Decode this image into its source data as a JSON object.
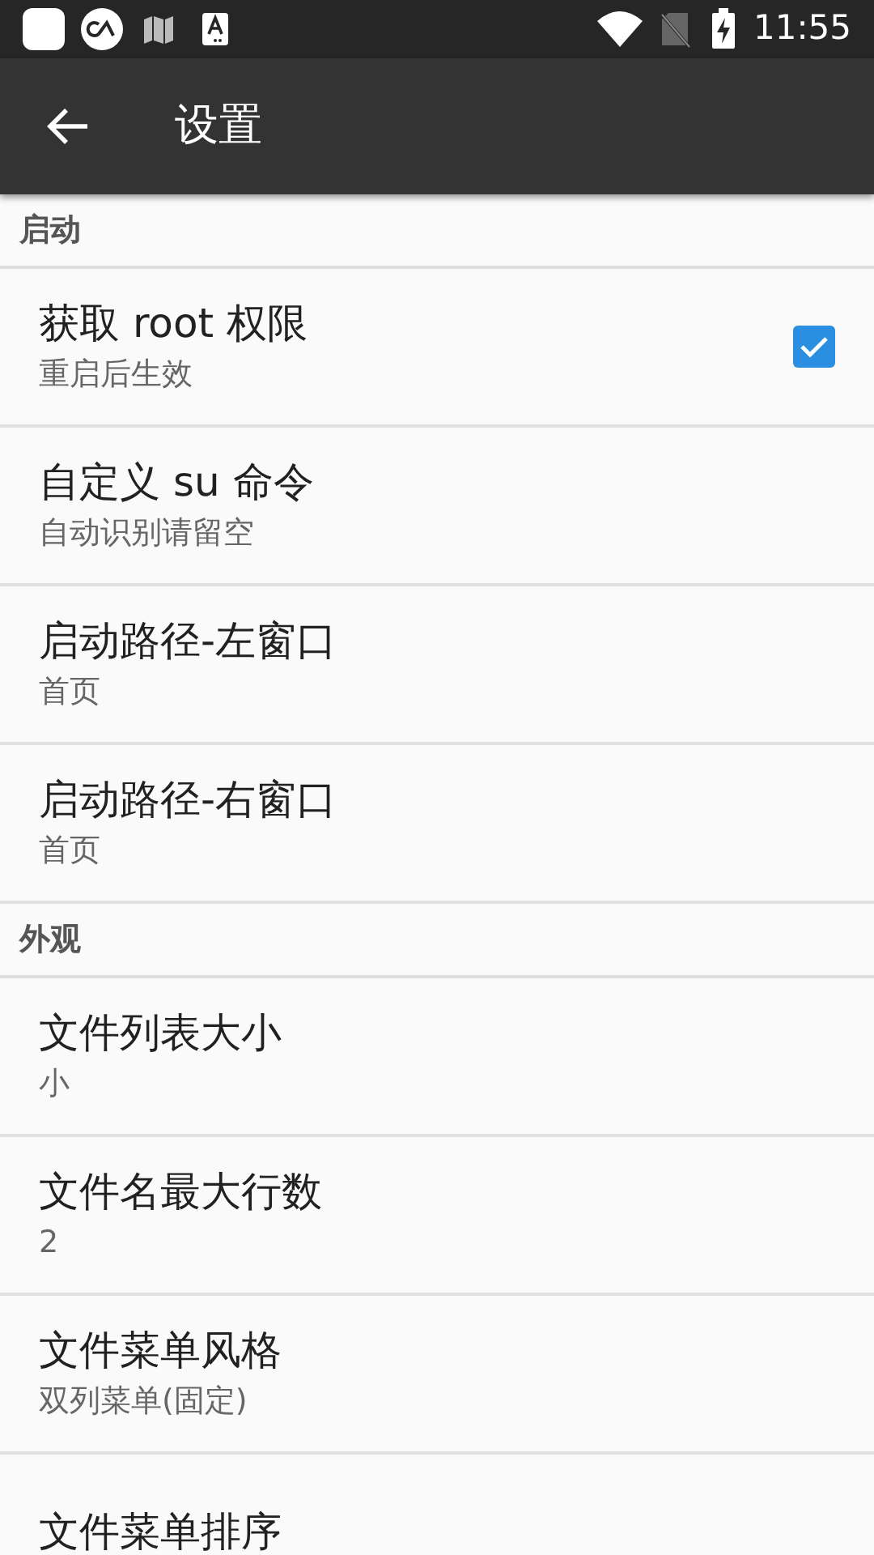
{
  "status_bar": {
    "time": "11:55"
  },
  "app_bar": {
    "title": "设置"
  },
  "sections": [
    {
      "header": "启动",
      "items": [
        {
          "kind": "checkbox",
          "title": "获取 root 权限",
          "subtitle": "重启后生效",
          "checked": true
        },
        {
          "kind": "text",
          "title": "自定义 su 命令",
          "subtitle": "自动识别请留空"
        },
        {
          "kind": "text",
          "title": "启动路径-左窗口",
          "subtitle": "首页"
        },
        {
          "kind": "text",
          "title": "启动路径-右窗口",
          "subtitle": "首页"
        }
      ]
    },
    {
      "header": "外观",
      "items": [
        {
          "kind": "text",
          "title": "文件列表大小",
          "subtitle": "小"
        },
        {
          "kind": "text",
          "title": "文件名最大行数",
          "subtitle": "2"
        },
        {
          "kind": "text",
          "title": "文件菜单风格",
          "subtitle": "双列菜单(固定)"
        },
        {
          "kind": "text",
          "title": "文件菜单排序"
        }
      ]
    }
  ]
}
